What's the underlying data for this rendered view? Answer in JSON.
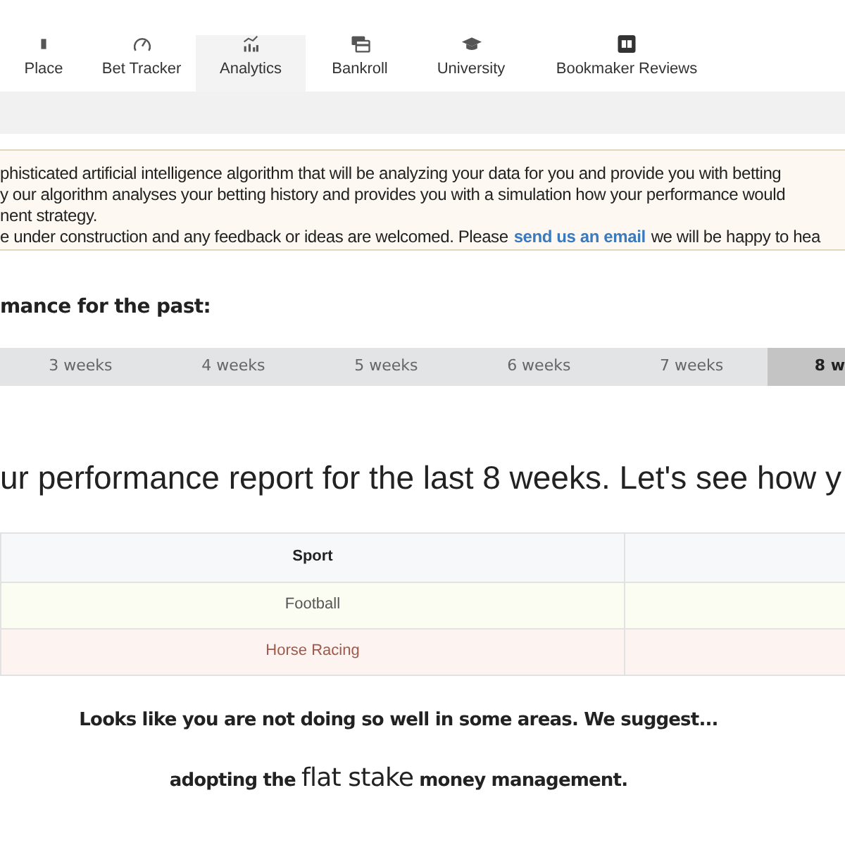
{
  "nav": [
    {
      "label": "Place",
      "selected": false
    },
    {
      "label": "Bet Tracker",
      "selected": false
    },
    {
      "label": "Analytics",
      "selected": true
    },
    {
      "label": "Bankroll",
      "selected": false
    },
    {
      "label": "University",
      "selected": false
    },
    {
      "label": "Bookmaker Reviews",
      "selected": false
    }
  ],
  "notice": {
    "lines": [
      "phisticated artificial intelligence algorithm that will be analyzing your data for you and provide you with betting",
      "y our algorithm analyses your betting history and provides you with a simulation how your performance would",
      "nent strategy."
    ],
    "last_line": {
      "before": "e under construction and any feedback or ideas are welcomed. Please",
      "link": "send us an email",
      "after": "we will be happy to hea"
    }
  },
  "period_label": "mance for the past:",
  "period_tabs": [
    {
      "label": "3 weeks",
      "selected": false
    },
    {
      "label": "4 weeks",
      "selected": false
    },
    {
      "label": "5 weeks",
      "selected": false
    },
    {
      "label": "6 weeks",
      "selected": false
    },
    {
      "label": "7 weeks",
      "selected": false
    },
    {
      "label": "8 w",
      "selected": true
    }
  ],
  "report_heading": "ur performance report for the last 8 weeks. Let's see how y",
  "table": {
    "columns": [
      "Sport"
    ],
    "rows": [
      {
        "sport": "Football",
        "kind": "good"
      },
      {
        "sport": "Horse Racing",
        "kind": "bad"
      }
    ]
  },
  "advice": "Looks like you are not doing so well in some areas. We suggest...",
  "suggestion": {
    "before": "adopting the",
    "highlight": "flat stake",
    "after": "money management."
  }
}
